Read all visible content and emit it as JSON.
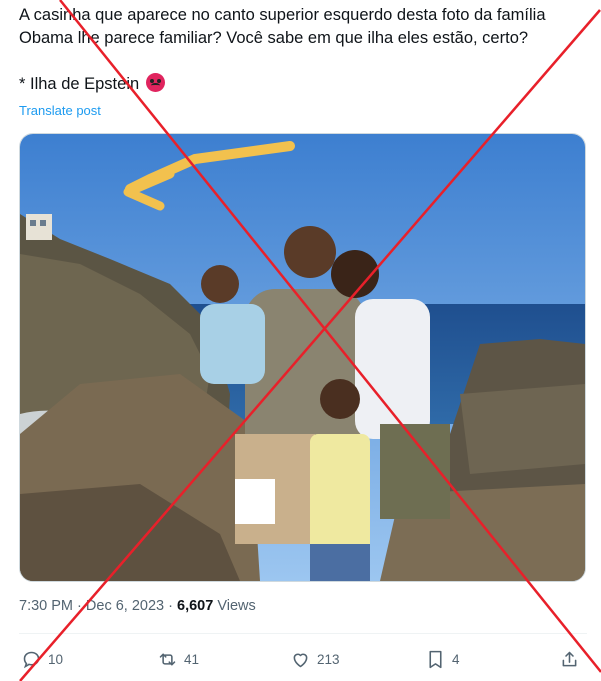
{
  "tweet": {
    "line1": "A casinha que aparece no canto superior esquerdo desta foto da família",
    "line2": "Obama lhe parece familiar? Você sabe em que ilha eles estão, certo?",
    "line3": "* Ilha de Epstein",
    "emoji": "angry-face-icon",
    "translate_label": "Translate post"
  },
  "meta": {
    "time": "7:30 PM",
    "separator": "·",
    "date": "Dec 6, 2023",
    "views_count": "6,607",
    "views_label": "Views"
  },
  "actions": {
    "reply_count": "10",
    "retweet_count": "41",
    "like_count": "213",
    "bookmark_count": "4"
  },
  "colors": {
    "link": "#1d9bf0",
    "secondary_text": "#536471",
    "cross": "#e8202a",
    "arrow": "#f2c14e"
  }
}
